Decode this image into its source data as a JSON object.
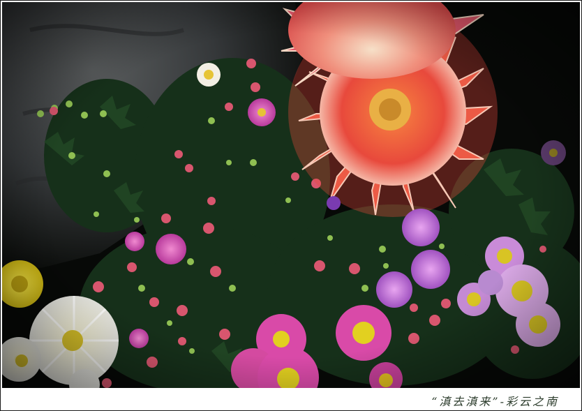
{
  "caption": {
    "text": "“滇去滇来”-彩云之南"
  },
  "colors": {
    "background": "#0a0c0a",
    "rock": "#3a3d3e",
    "foliage": "#1f3a1c",
    "dahlia": "#e8553c",
    "dahlia_tips": "#f7c9b6",
    "daisy_pink": "#d94aa8",
    "daisy_violet": "#b96fd6",
    "white_mum": "#f4f2ea",
    "yellow_mum": "#e7d21c",
    "caption_text": "#2a3a2a"
  }
}
